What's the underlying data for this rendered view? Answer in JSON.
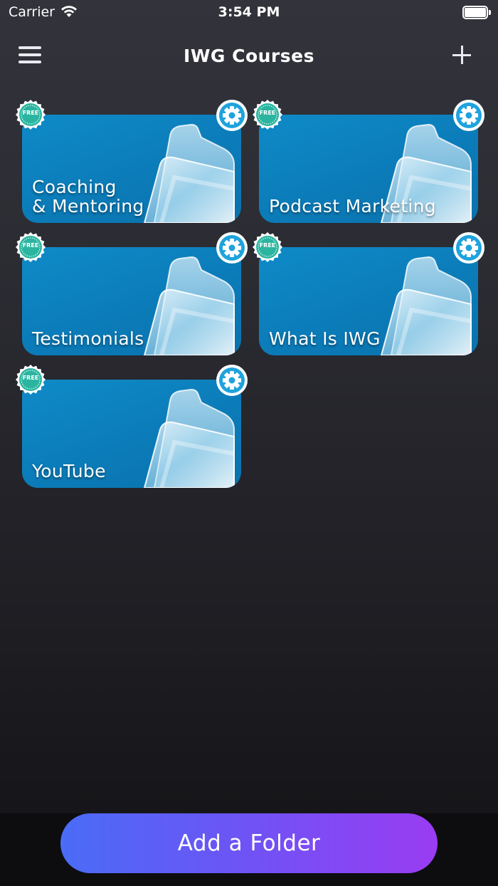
{
  "status_bar": {
    "carrier": "Carrier",
    "time": "3:54 PM"
  },
  "nav": {
    "title": "IWG Courses",
    "menu_icon": "hamburger-menu-icon",
    "add_icon": "plus-icon"
  },
  "folders": [
    {
      "label": "Coaching\n& Mentoring",
      "badge": "FREE"
    },
    {
      "label": "Podcast Marketing",
      "badge": "FREE"
    },
    {
      "label": "Testimonials",
      "badge": "FREE"
    },
    {
      "label": "What Is IWG",
      "badge": "FREE"
    },
    {
      "label": "YouTube",
      "badge": "FREE"
    }
  ],
  "add_folder_button": "Add a Folder",
  "colors": {
    "card_blue": "#0b7dba",
    "badge_green": "#2bb5a0",
    "gear_blue": "#1fa3dc",
    "button_gradient_start": "#4a6cf7",
    "button_gradient_end": "#9a3cf2"
  }
}
